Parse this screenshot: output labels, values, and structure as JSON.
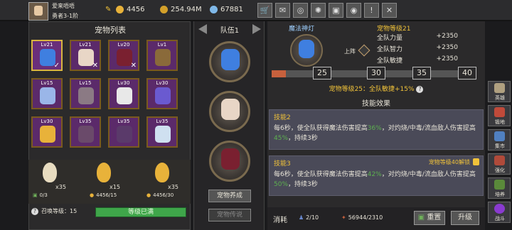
{
  "player": {
    "name": "爱来唔唔",
    "rank": "勇者3-1阶"
  },
  "currency": [
    {
      "icon": "coin-icon",
      "value": "4456",
      "color": "#e8b23a"
    },
    {
      "icon": "gold-icon",
      "value": "254.94M",
      "color": "#d3a02a"
    },
    {
      "icon": "gem-icon",
      "value": "67881",
      "color": "#7fb8e8"
    }
  ],
  "toolbar": [
    "cart-icon",
    "mail-icon",
    "portal-icon",
    "settings-icon",
    "gift-icon",
    "map-icon",
    "alert-icon",
    "close-icon"
  ],
  "left": {
    "title": "宠物列表",
    "pets": [
      {
        "lv": "Lv21",
        "color": "#3f7fe0",
        "mark": "✓",
        "selected": true
      },
      {
        "lv": "Lv21",
        "color": "#e8d6c6",
        "mark": "✕"
      },
      {
        "lv": "Lv20",
        "color": "#7a2030",
        "mark": "✕"
      },
      {
        "lv": "Lv1",
        "color": "#8a6a3a",
        "mark": ""
      },
      {
        "lv": "Lv15",
        "color": "#9ab6e8",
        "mark": ""
      },
      {
        "lv": "Lv15",
        "color": "#8b7a84",
        "mark": ""
      },
      {
        "lv": "Lv30",
        "color": "#e8e8e8",
        "mark": ""
      },
      {
        "lv": "Lv30",
        "color": "#6a5ad0",
        "mark": ""
      },
      {
        "lv": "Lv30",
        "color": "#e8b23a",
        "mark": ""
      },
      {
        "lv": "Lv35",
        "color": "#6a4a6a",
        "mark": ""
      },
      {
        "lv": "Lv35",
        "color": "#5a3a6a",
        "mark": ""
      },
      {
        "lv": "Lv35",
        "color": "#cfe0f0",
        "mark": ""
      }
    ],
    "eggs": [
      {
        "count": "x35",
        "progress": "0/3",
        "color": "#e8dcc0"
      },
      {
        "count": "x15",
        "progress": "4456/15",
        "color": "#e8b23a"
      },
      {
        "count": "x35",
        "progress": "4456/30",
        "color": "#e8b23a"
      }
    ],
    "summon_label": "召唤等级：15",
    "summon_status": "等级已满"
  },
  "middle": {
    "team_label": "队伍1",
    "train_label": "宠物养成",
    "mode_label": "宠物传说"
  },
  "right": {
    "pet_name": "魔法神灯",
    "pet_level": "宠物等级21",
    "on_label": "上阵",
    "stats": [
      {
        "name": "全队力量",
        "value": "+2350"
      },
      {
        "name": "全队智力",
        "value": "+2350"
      },
      {
        "name": "全队敏捷",
        "value": "+2350"
      }
    ],
    "level_marks": [
      "25",
      "30",
      "35",
      "40"
    ],
    "level_progress": 0.07,
    "bonus_note": "宠物等级25：全队敏捷+15%",
    "skill_header": "技能效果",
    "skills": [
      {
        "name": "技能2",
        "desc_a": "每6秒，使全队获得魔法伤害提高",
        "pct_a": "36%",
        "desc_b": "，对灼烧/中毒/流血敌人伤害提高",
        "pct_b": "45%",
        "desc_c": "，持续3秒",
        "lock": ""
      },
      {
        "name": "技能3",
        "desc_a": "每6秒，使全队获得魔法伤害提高",
        "pct_a": "42%",
        "desc_b": "，对灼烧/中毒/流血敌人伤害提高",
        "pct_b": "50%",
        "desc_c": "，持续3秒",
        "lock": "宠物等级40解锁"
      }
    ],
    "cost_label": "消耗",
    "cost_a": "2/10",
    "cost_b": "56944/2310",
    "reset_label": "重置",
    "upgrade_label": "升级"
  },
  "sidebar": [
    {
      "label": "英雄",
      "color": "#b0a080"
    },
    {
      "label": "锻地",
      "color": "#c04a3a"
    },
    {
      "label": "集市",
      "color": "#5080c0"
    },
    {
      "label": "强化",
      "color": "#b04a3a"
    },
    {
      "label": "培养",
      "color": "#5a8a3a"
    },
    {
      "label": "战斗",
      "color": "#8a3ad0"
    }
  ]
}
